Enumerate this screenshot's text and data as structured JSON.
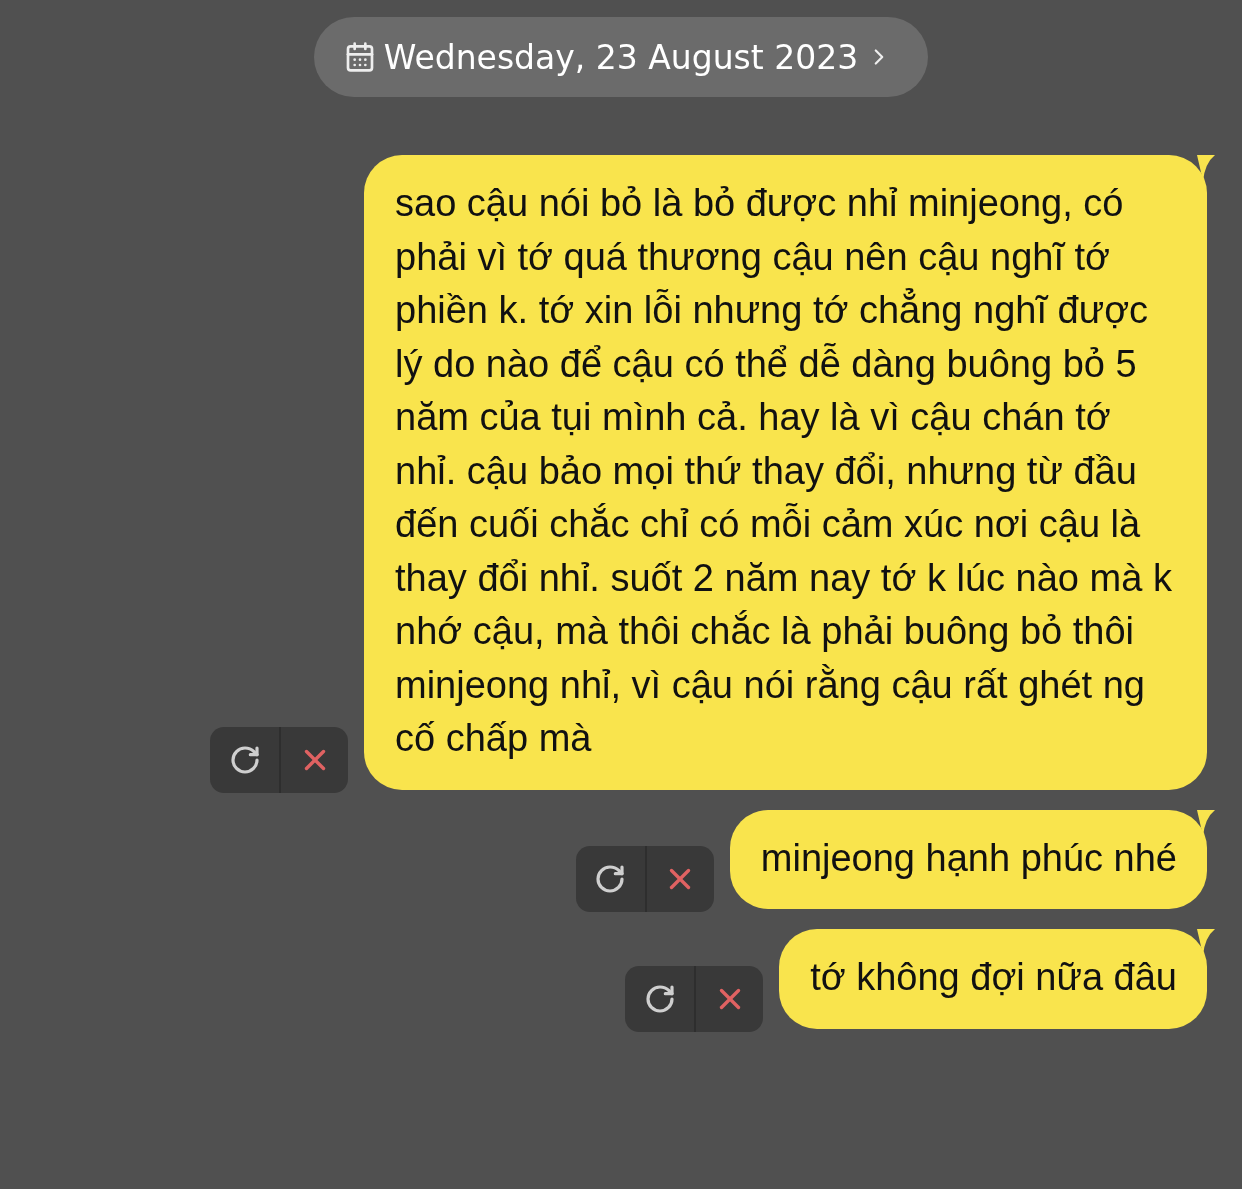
{
  "date_header": {
    "label": "Wednesday, 23 August 2023"
  },
  "messages": [
    {
      "text": "sao cậu nói bỏ là bỏ được nhỉ minjeong, có phải vì tớ quá thương cậu nên cậu nghĩ tớ phiền k. tớ xin lỗi nhưng tớ chẳng nghĩ được lý do nào để cậu có thể dễ dàng buông bỏ 5 năm của tụi mình cả. hay là vì cậu chán tớ nhỉ. cậu bảo mọi thứ thay đổi, nhưng từ đầu đến cuối chắc chỉ có mỗi cảm xúc nơi cậu là thay đổi nhỉ. suốt 2 năm nay tớ k lúc nào mà k nhớ cậu, mà thôi chắc là phải buông bỏ thôi minjeong nhỉ, vì cậu nói rằng cậu rất ghét ng cố chấp mà",
      "failed": true
    },
    {
      "text": "minjeong hạnh phúc nhé",
      "failed": true
    },
    {
      "text": "tớ không đợi nữa đâu",
      "failed": true
    }
  ]
}
